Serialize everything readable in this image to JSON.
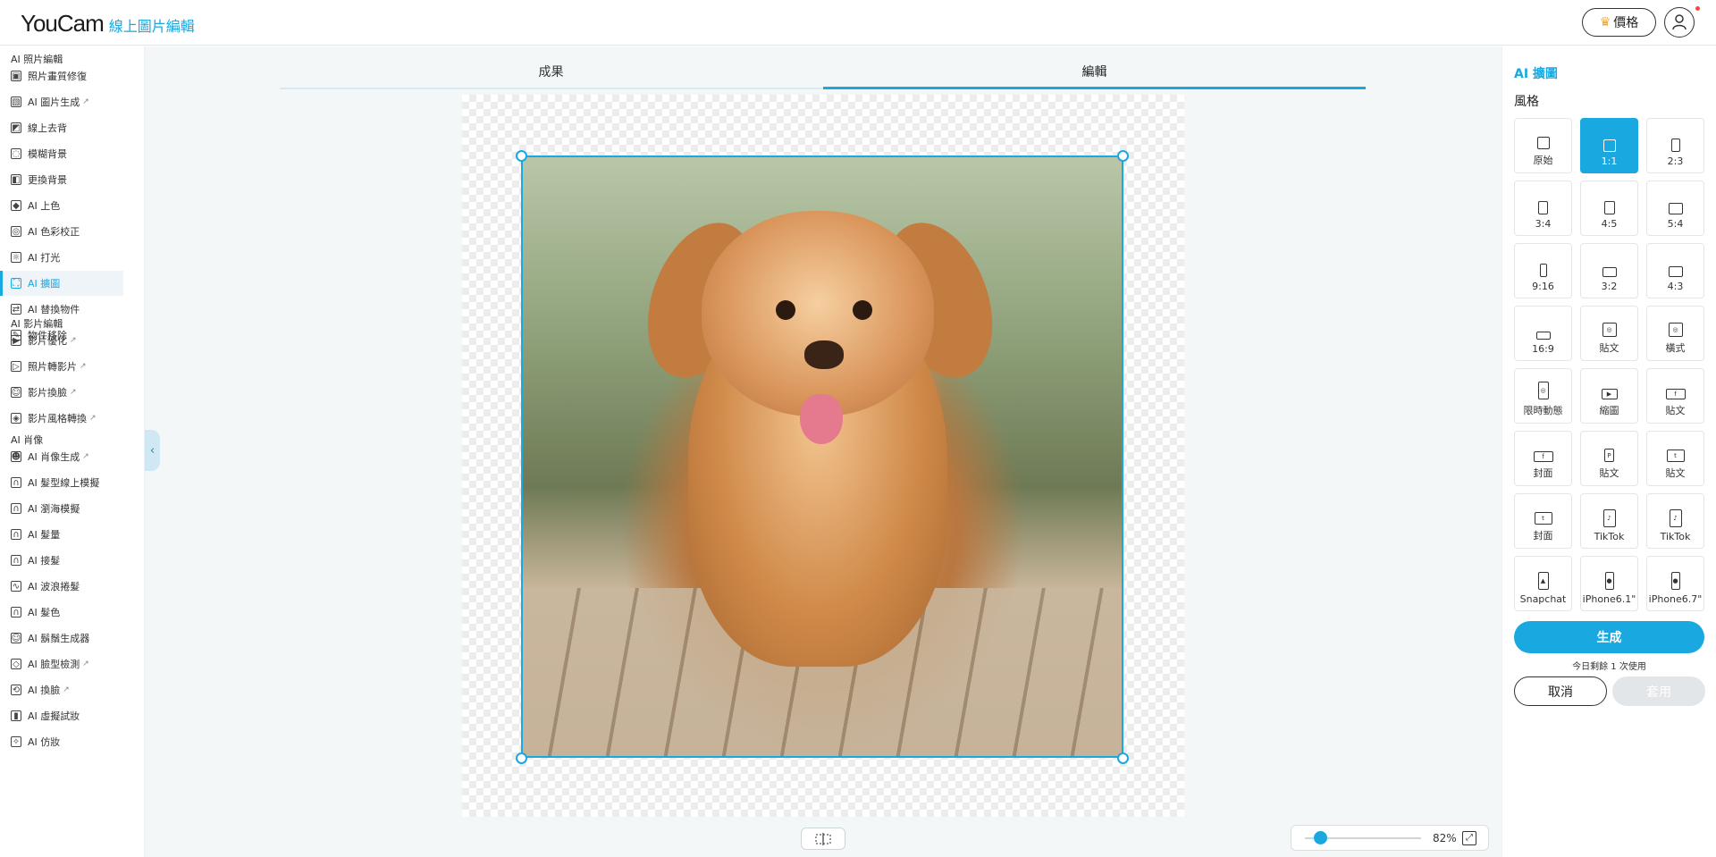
{
  "header": {
    "logo_main": "YouCam",
    "logo_sub": "線上圖片編輯",
    "price_label": "價格",
    "crown": "♛"
  },
  "sidebar": {
    "sections": [
      {
        "title": "AI 照片編輯",
        "items": [
          {
            "label": "照片畫質修復",
            "icon": "image-enhance-icon",
            "ext": false
          },
          {
            "label": "AI 圖片生成",
            "icon": "ai-image-icon",
            "ext": true
          },
          {
            "label": "線上去背",
            "icon": "remove-bg-icon",
            "ext": false
          },
          {
            "label": "模糊背景",
            "icon": "blur-icon",
            "ext": false
          },
          {
            "label": "更換背景",
            "icon": "change-bg-icon",
            "ext": false
          },
          {
            "label": "AI 上色",
            "icon": "colorize-icon",
            "ext": false
          },
          {
            "label": "AI 色彩校正",
            "icon": "color-correct-icon",
            "ext": false
          },
          {
            "label": "AI 打光",
            "icon": "light-icon",
            "ext": false
          },
          {
            "label": "AI 擴圖",
            "icon": "expand-icon",
            "ext": false,
            "active": true
          },
          {
            "label": "AI 替換物件",
            "icon": "replace-icon",
            "ext": false
          },
          {
            "label": "物件移除",
            "icon": "eraser-icon",
            "ext": false
          }
        ]
      },
      {
        "title": "AI 影片編輯",
        "items": [
          {
            "label": "影片優化",
            "icon": "video-enhance-icon",
            "ext": true
          },
          {
            "label": "照片轉影片",
            "icon": "photo-to-video-icon",
            "ext": true
          },
          {
            "label": "影片換臉",
            "icon": "video-face-swap-icon",
            "ext": true
          },
          {
            "label": "影片風格轉換",
            "icon": "video-style-icon",
            "ext": true
          }
        ]
      },
      {
        "title": "AI 肖像",
        "items": [
          {
            "label": "AI 肖像生成",
            "icon": "portrait-icon",
            "ext": true
          },
          {
            "label": "AI 髮型線上模擬",
            "icon": "hairstyle-icon",
            "ext": false
          },
          {
            "label": "AI 瀏海模擬",
            "icon": "bangs-icon",
            "ext": false
          },
          {
            "label": "AI 髮量",
            "icon": "hair-volume-icon",
            "ext": false
          },
          {
            "label": "AI 接髮",
            "icon": "hair-extension-icon",
            "ext": false
          },
          {
            "label": "AI 波浪捲髮",
            "icon": "wavy-hair-icon",
            "ext": false
          },
          {
            "label": "AI 髮色",
            "icon": "hair-color-icon",
            "ext": false
          },
          {
            "label": "AI 鬍鬚生成器",
            "icon": "beard-icon",
            "ext": false
          },
          {
            "label": "AI 臉型檢測",
            "icon": "face-shape-icon",
            "ext": true
          },
          {
            "label": "AI 換臉",
            "icon": "face-swap-icon",
            "ext": true
          },
          {
            "label": "AI 虛擬試妝",
            "icon": "lipstick-icon",
            "ext": false
          },
          {
            "label": "AI 仿妝",
            "icon": "makeup-copy-icon",
            "ext": false
          }
        ]
      }
    ]
  },
  "tabs": {
    "result": "成果",
    "edit": "編輯"
  },
  "zoom": {
    "value": "82%",
    "level": 0.82
  },
  "panel": {
    "title": "AI 擴圖",
    "subtitle": "風格",
    "options": [
      {
        "label": "原始",
        "shape": "square",
        "active": false
      },
      {
        "label": "1:1",
        "shape": "square",
        "active": true
      },
      {
        "label": "2:3",
        "shape": "portrait-2-3",
        "active": false
      },
      {
        "label": "3:4",
        "shape": "portrait-3-4",
        "active": false
      },
      {
        "label": "4:5",
        "shape": "portrait-4-5",
        "active": false
      },
      {
        "label": "5:4",
        "shape": "landscape-5-4",
        "active": false
      },
      {
        "label": "9:16",
        "shape": "portrait-9-16",
        "active": false
      },
      {
        "label": "3:2",
        "shape": "landscape-3-2",
        "active": false
      },
      {
        "label": "4:3",
        "shape": "landscape-4-3",
        "active": false
      },
      {
        "label": "16:9",
        "shape": "landscape-16-9",
        "active": false
      },
      {
        "label": "貼文",
        "shape": "instagram-icon",
        "active": false
      },
      {
        "label": "橫式",
        "shape": "instagram-icon",
        "active": false
      },
      {
        "label": "限時動態",
        "shape": "instagram-story-icon",
        "active": false
      },
      {
        "label": "縮圖",
        "shape": "youtube-icon",
        "active": false
      },
      {
        "label": "貼文",
        "shape": "facebook-icon",
        "active": false
      },
      {
        "label": "封面",
        "shape": "facebook-icon",
        "active": false
      },
      {
        "label": "貼文",
        "shape": "pinterest-icon",
        "active": false
      },
      {
        "label": "貼文",
        "shape": "twitter-icon",
        "active": false
      },
      {
        "label": "封面",
        "shape": "twitter-icon",
        "active": false
      },
      {
        "label": "TikTok",
        "shape": "tiktok-icon",
        "active": false
      },
      {
        "label": "TikTok",
        "shape": "tiktok-icon",
        "active": false
      },
      {
        "label": "Snapchat",
        "shape": "snapchat-icon",
        "active": false
      },
      {
        "label": "iPhone6.1\"",
        "shape": "apple-icon",
        "active": false
      },
      {
        "label": "iPhone6.7\"",
        "shape": "apple-icon",
        "active": false
      }
    ],
    "generate_label": "生成",
    "remaining_text": "今日剩餘 1 次使用",
    "cancel_label": "取消",
    "apply_label": "套用"
  },
  "colors": {
    "accent": "#1aa8e0"
  }
}
